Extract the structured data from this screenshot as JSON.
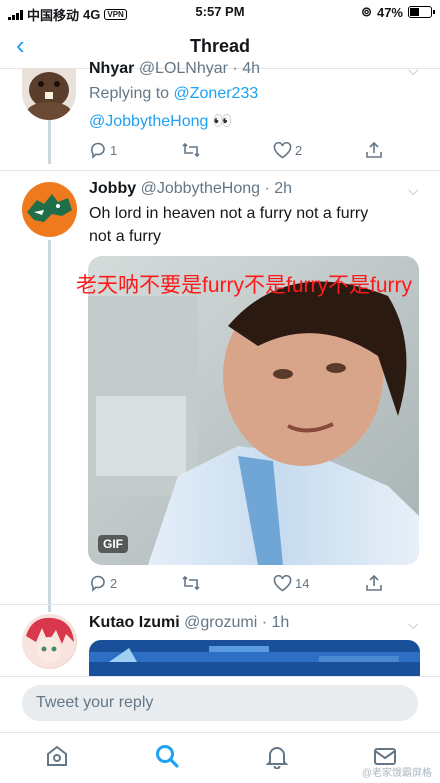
{
  "status_bar": {
    "carrier": "中国移动",
    "network": "4G",
    "vpn": "VPN",
    "time": "5:57 PM",
    "battery": "47%",
    "battery_level": 0.47
  },
  "header": {
    "title": "Thread"
  },
  "tweets": [
    {
      "name": "Nhyar",
      "handle": "@LOLNhyar",
      "time": "· 4h",
      "replying_prefix": "Replying to",
      "replying_to": "@Zoner233",
      "mention": "@JobbytheHong",
      "emoji": "👀",
      "replies": "1",
      "retweets": "",
      "likes": "2"
    },
    {
      "name": "Jobby",
      "handle": "@JobbytheHong",
      "time": "· 2h",
      "text_line1": "Oh lord in heaven not a furry not a furry",
      "text_line2": "not a furry",
      "gif_caption": "老天呐不要是furry不是furry不是furry",
      "gif_label": "GIF",
      "replies": "2",
      "retweets": "",
      "likes": "14"
    },
    {
      "name": "Kutao Izumi",
      "handle": "@grozumi",
      "time": "· 1h"
    }
  ],
  "reply_box": {
    "placeholder": "Tweet your reply"
  },
  "tabbar": [
    "home-icon",
    "search-icon",
    "notifications-icon",
    "messages-icon"
  ],
  "watermark": "@老家饿霸屏格",
  "colors": {
    "accent": "#1da1f2",
    "secondary_text": "#657786",
    "thread_line": "#ccd6dd"
  }
}
